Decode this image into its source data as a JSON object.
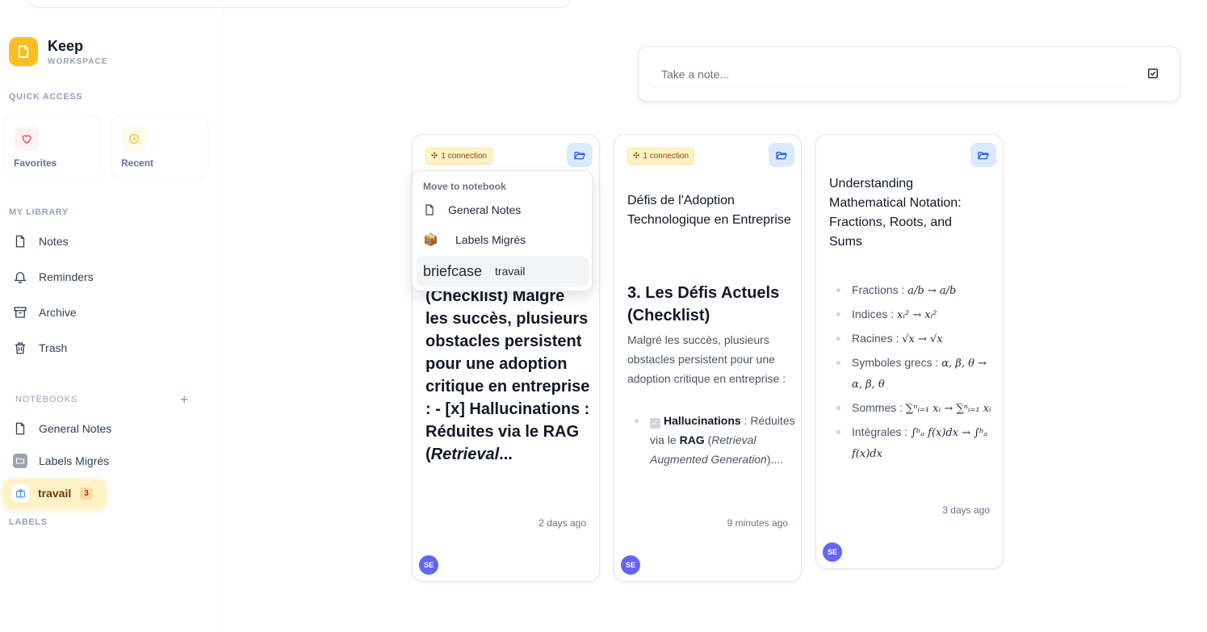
{
  "brand": {
    "name": "Keep",
    "subtitle": "WORKSPACE"
  },
  "sidebar": {
    "quick_access_label": "QUICK ACCESS",
    "quick_access": [
      {
        "label": "Favorites"
      },
      {
        "label": "Recent"
      }
    ],
    "library_label": "MY LIBRARY",
    "library": [
      {
        "label": "Notes"
      },
      {
        "label": "Reminders"
      },
      {
        "label": "Archive"
      },
      {
        "label": "Trash"
      }
    ],
    "notebooks_label": "NOTEBOOKS",
    "add_icon": "+",
    "notebooks": [
      {
        "label": "General Notes"
      },
      {
        "label": "Labels Migrés"
      }
    ],
    "active_notebook": {
      "label": "travail",
      "count": "3"
    },
    "labels_label": "LABELS"
  },
  "composer": {
    "placeholder": "Take a note..."
  },
  "dropdown": {
    "header": "Move to notebook",
    "items": [
      {
        "icon": "",
        "label": "General Notes"
      },
      {
        "icon": "📦",
        "label": "Labels Migrés"
      },
      {
        "icon": "briefcase",
        "label": "travail"
      }
    ]
  },
  "notes": [
    {
      "badge": "1 connection",
      "big_text": "(Checklist) Malgré les succès, plusieurs obstacles persistent pour une adoption critique en entreprise : - [x] Hallucinations : Réduites via le RAG (",
      "big_text_em": "Retrieval",
      "big_text_tail": "...",
      "time": "2 days ago",
      "avatar": "SE"
    },
    {
      "badge": "1 connection",
      "title": "Défis de l'Adoption Technologique en Entreprise",
      "heading": "3. Les Défis Actuels (Checklist)",
      "body": "Malgré les succès, plusieurs obstacles persistent pour une adoption critique en entreprise :",
      "item_bold": "Hallucinations",
      "item_mid": " : Réduites via le ",
      "item_bold2": "RAG",
      "item_open": " (",
      "item_em": "Retrieval Augmented Generation",
      "item_close": ")....",
      "time": "9 minutes ago",
      "avatar": "SE"
    },
    {
      "title": "Understanding Mathematical Notation: Fractions, Roots, and Sums",
      "items": [
        {
          "label": "Fractions : ",
          "math": "a/b → a/b"
        },
        {
          "label": "Indices : ",
          "math": "xᵢ² → xᵢ²"
        },
        {
          "label": "Racines : ",
          "math": "√x → √x"
        },
        {
          "label": "Symboles grecs : ",
          "math": "α, β, θ → α, β, θ"
        },
        {
          "label": "Sommes : ",
          "math": "∑ⁿᵢ₌₁ xᵢ → ∑ⁿᵢ₌₁ xᵢ"
        },
        {
          "label": "Intégrales : ",
          "math": "∫ᵇₐ f(x)dx → ∫ᵇₐ f(x)dx"
        }
      ],
      "time": "3 days ago",
      "avatar": "SE"
    }
  ]
}
